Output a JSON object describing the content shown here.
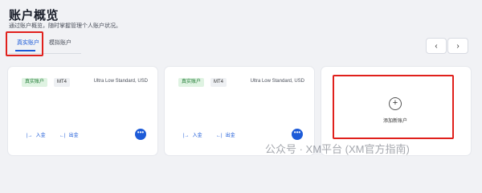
{
  "header": {
    "title": "账户概览",
    "subtitle": "通过账户概览，随时掌握管理个人账户状况。"
  },
  "tabs": [
    {
      "label": "真实账户",
      "active": true
    },
    {
      "label": "模拟账户",
      "active": false
    }
  ],
  "pager": {
    "prev": "‹",
    "next": "›"
  },
  "accounts": [
    {
      "badge_type": "真实账户",
      "badge_platform": "MT4",
      "account_type": "Ultra Low Standard, USD",
      "deposit_label": "入金",
      "withdraw_label": "出金",
      "more_label": "•••"
    },
    {
      "badge_type": "真实账户",
      "badge_platform": "MT4",
      "account_type": "Ultra Low Standard, USD",
      "deposit_label": "入金",
      "withdraw_label": "出金",
      "more_label": "•••"
    }
  ],
  "add_account": {
    "icon": "+",
    "label": "添加新账户"
  },
  "watermark": "公众号 · XM平台 (XM官方指南)",
  "colors": {
    "accent": "#1d5bd8",
    "highlight_red": "#e0201c",
    "badge_green_bg": "#dff3e2",
    "badge_green_text": "#1e7a33"
  }
}
